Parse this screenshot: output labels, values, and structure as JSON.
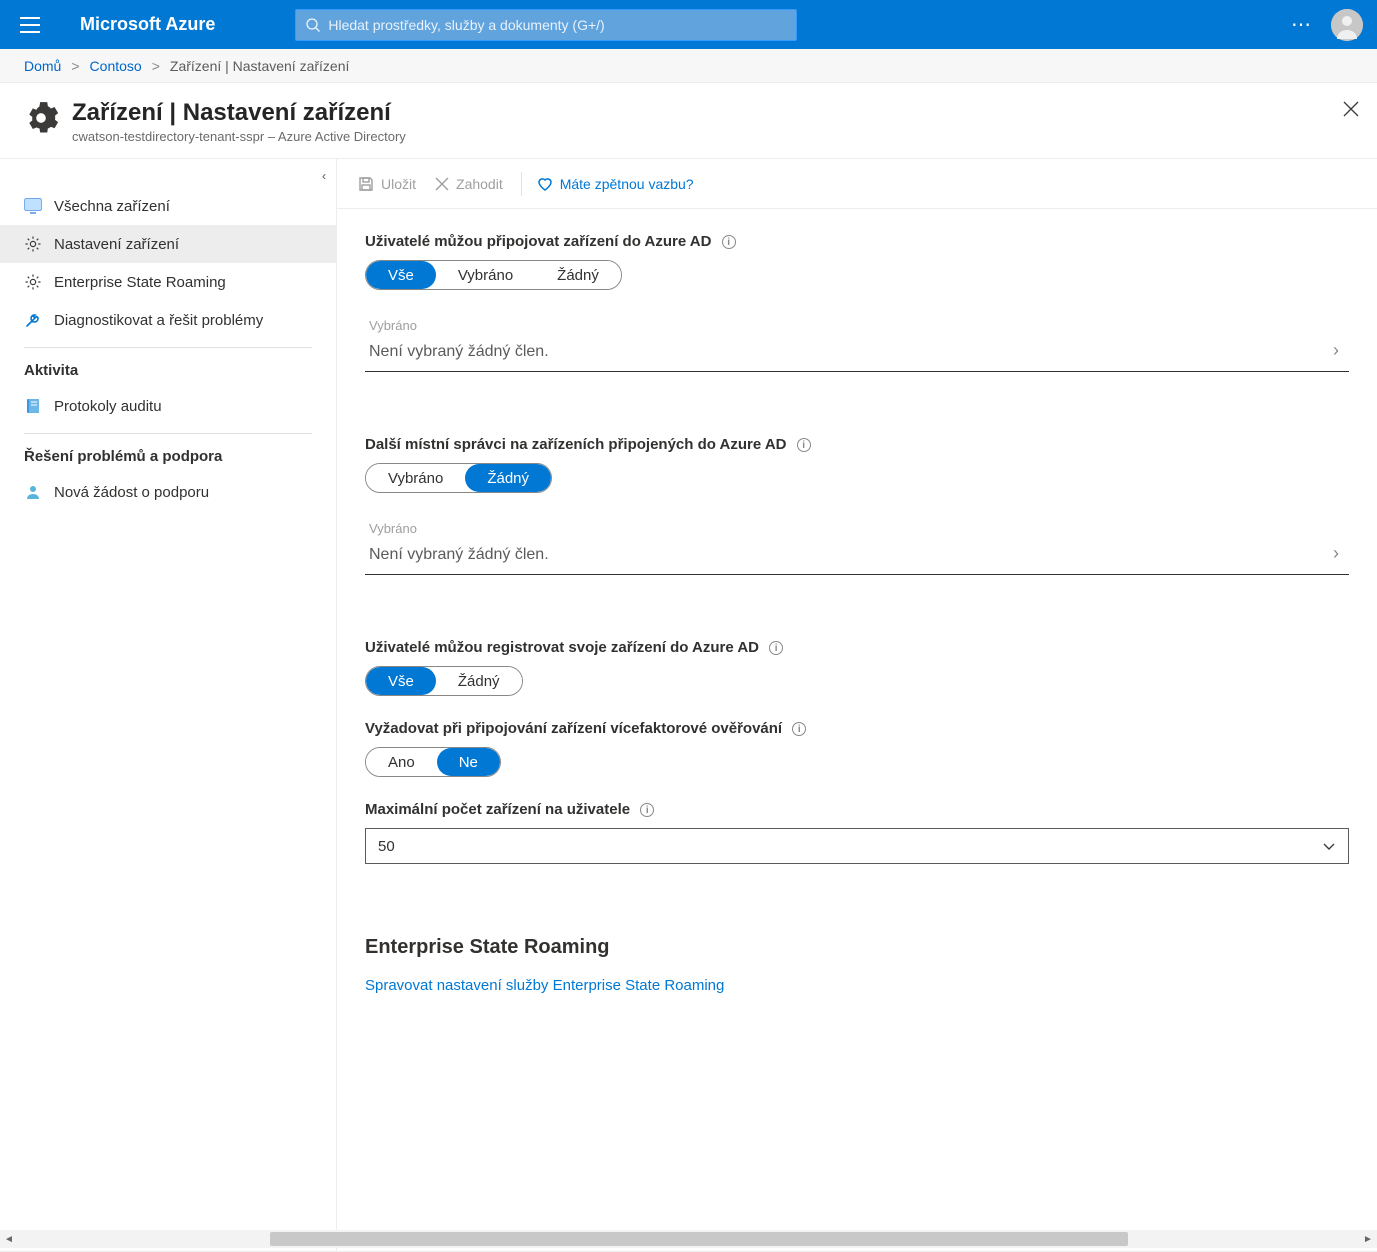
{
  "header": {
    "brand": "Microsoft Azure",
    "search_placeholder": "Hledat prostředky, služby a dokumenty (G+/)"
  },
  "breadcrumb": {
    "home": "Domů",
    "org": "Contoso",
    "current": "Zařízení | Nastavení zařízení"
  },
  "page": {
    "title": "Zařízení | Nastavení zařízení",
    "subtitle": "cwatson-testdirectory-tenant-sspr – Azure Active Directory"
  },
  "toolbar": {
    "save": "Uložit",
    "discard": "Zahodit",
    "feedback": "Máte zpětnou vazbu?"
  },
  "sidebar": {
    "items": [
      {
        "label": "Všechna zařízení"
      },
      {
        "label": "Nastavení zařízení"
      },
      {
        "label": "Enterprise State Roaming"
      },
      {
        "label": "Diagnostikovat a řešit problémy"
      }
    ],
    "activity_title": "Aktivita",
    "activity_items": [
      {
        "label": "Protokoly auditu"
      }
    ],
    "support_title": "Řešení problémů a podpora",
    "support_items": [
      {
        "label": "Nová žádost o podporu"
      }
    ]
  },
  "form": {
    "join_label": "Uživatelé můžou připojovat zařízení do Azure AD",
    "join_options": {
      "all": "Vše",
      "selected": "Vybráno",
      "none": "Žádný"
    },
    "picker_title": "Vybráno",
    "picker_empty": "Není vybraný žádný člen.",
    "admins_label": "Další místní správci na zařízeních připojených do Azure AD",
    "admins_options": {
      "selected": "Vybráno",
      "none": "Žádný"
    },
    "register_label": "Uživatelé můžou registrovat svoje zařízení do Azure AD",
    "register_options": {
      "all": "Vše",
      "none": "Žádný"
    },
    "mfa_label": "Vyžadovat při připojování zařízení vícefaktorové ověřování",
    "mfa_options": {
      "yes": "Ano",
      "no": "Ne"
    },
    "max_label": "Maximální počet zařízení na uživatele",
    "max_value": "50",
    "esr_title": "Enterprise State Roaming",
    "esr_link": "Spravovat nastavení služby Enterprise State Roaming"
  }
}
